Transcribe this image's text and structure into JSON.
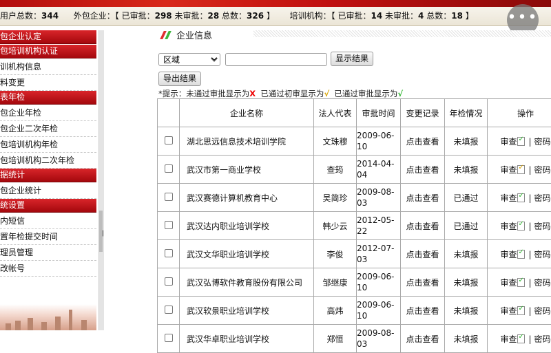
{
  "status": {
    "users_label": "用户总数：",
    "users_total": "344",
    "outsource_label": "外包企业：【",
    "outsource_approved_label": "已审批：",
    "outsource_approved": "298",
    "outsource_pending_label": "未审批：",
    "outsource_pending": "28",
    "outsource_total_label": "总数：",
    "outsource_total": "326",
    "outsource_close": "】",
    "training_label": "培训机构：【",
    "training_approved_label": "已审批：",
    "training_approved": "14",
    "training_pending_label": "未审批：",
    "training_pending": "4",
    "training_total_label": "总数：",
    "training_total": "18",
    "training_close": "】"
  },
  "menu_button": {
    "glyph": "•••",
    "icon": "more-horizontal-icon"
  },
  "sidebar": {
    "groups": [
      {
        "title": "包企业认定",
        "items": []
      },
      {
        "title": "包培训机构认证",
        "items": [
          "训机构信息",
          "料变更"
        ]
      },
      {
        "title": "表年检",
        "items": [
          "包企业年检",
          "包企业二次年检",
          "包培训机构年检",
          "包培训机构二次年检"
        ]
      },
      {
        "title": "据统计",
        "items": [
          "包企业统计"
        ]
      },
      {
        "title": "统设置",
        "items": [
          "内短信",
          "置年检提交时间",
          "理员管理",
          "改帐号"
        ]
      }
    ]
  },
  "page": {
    "title": "企业信息",
    "region_select": "区域",
    "search_value": "",
    "show_results": "显示结果",
    "export_results": "导出结果",
    "hint_prefix": "*提示：未通过审批显示为",
    "hint_x": "X",
    "hint_mid1": "  已通过初审显示为",
    "hint_check1": "√",
    "hint_mid2": "  已通过审批显示为",
    "hint_check2": "√"
  },
  "table": {
    "headers": [
      "",
      "企业名称",
      "法人代表",
      "审批时间",
      "变更记录",
      "年检情况",
      "操作"
    ],
    "view_label": "点击查看",
    "review_label": "审查",
    "password_label": "密码",
    "divider": "|",
    "rows": [
      {
        "name": "湖北思远信息技术培训学院",
        "rep": "文珠穆",
        "date": "2009-06-10",
        "annual": "未填报",
        "status": "approved"
      },
      {
        "name": "武汉市第一商业学校",
        "rep": "查筠",
        "date": "2014-04-04",
        "annual": "未填报",
        "status": "first"
      },
      {
        "name": "武汉赛德计算机教育中心",
        "rep": "吴简珍",
        "date": "2009-08-03",
        "annual": "已通过",
        "status": "approved"
      },
      {
        "name": "武汉达内职业培训学校",
        "rep": "韩少云",
        "date": "2012-05-22",
        "annual": "已通过",
        "status": "approved"
      },
      {
        "name": "武汉文华职业培训学校",
        "rep": "李俊",
        "date": "2012-07-03",
        "annual": "未填报",
        "status": "approved"
      },
      {
        "name": "武汉弘博软件教育股份有限公司",
        "rep": "邹继康",
        "date": "2009-06-10",
        "annual": "未填报",
        "status": "approved"
      },
      {
        "name": "武汉软景职业培训学校",
        "rep": "高炜",
        "date": "2009-06-10",
        "annual": "未填报",
        "status": "approved"
      },
      {
        "name": "武汉华卓职业培训学校",
        "rep": "郑恒",
        "date": "2009-08-03",
        "annual": "未填报",
        "status": "approved"
      }
    ]
  },
  "colors": {
    "banner": "#c01010",
    "sidebar_header": "#c8171c",
    "reject_mark": "#ee0000",
    "first_check": "#d9a400",
    "approved_check": "#2fb52f"
  }
}
